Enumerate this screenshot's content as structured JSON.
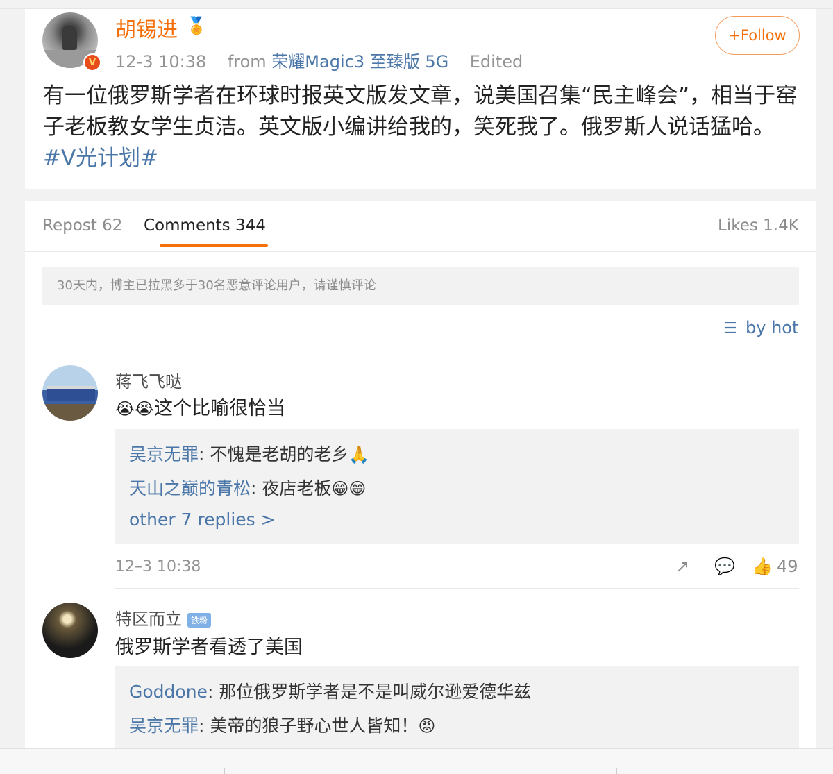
{
  "post": {
    "author": "胡锡进",
    "author_badge_icon": "medal-icon",
    "timestamp": "12-3 10:38",
    "from_label": "from",
    "device": "荣耀Magic3 至臻版 5G",
    "edited": "Edited",
    "follow_label": "+Follow",
    "text_main": "有一位俄罗斯学者在环球时报英文版发文章，说美国召集“民主峰会”，相当于窑子老板教女学生贞洁。英文版小编讲给我的，笑死我了。俄罗斯人说话猛哈。",
    "topic": "#V光计划#"
  },
  "tabs": {
    "repost": "Repost 62",
    "comments": "Comments 344",
    "likes": "Likes 1.4K"
  },
  "notice": "30天内，博主已拉黑多于30名恶意评论用户，请谨慎评论",
  "sort_label": "by hot",
  "comments": [
    {
      "name": "蒋飞飞哒",
      "emoji": "😭😭",
      "text": "这个比喻很恰当",
      "replies": [
        {
          "name": "吴京无罪",
          "text": ": 不愧是老胡的老乡",
          "emoji": "🙏"
        },
        {
          "name": "天山之巅的青松",
          "text": ": 夜店老板",
          "emoji": "😁😁"
        }
      ],
      "more_replies": "other 7 replies >",
      "time": "12–3 10:38",
      "likes": "49"
    },
    {
      "name": "特区而立",
      "badge": "铁粉",
      "text": "俄罗斯学者看透了美国",
      "replies": [
        {
          "name": "Goddone",
          "text": ": 那位俄罗斯学者是不是叫威尔逊爱德华兹",
          "emoji": ""
        },
        {
          "name": "吴京无罪",
          "text": ": 美帝的狼子野心世人皆知！",
          "emoji": "😡"
        }
      ]
    }
  ],
  "colors": {
    "accent_orange": "#f5700a",
    "link_blue": "#4a76a8",
    "muted": "#939393"
  }
}
